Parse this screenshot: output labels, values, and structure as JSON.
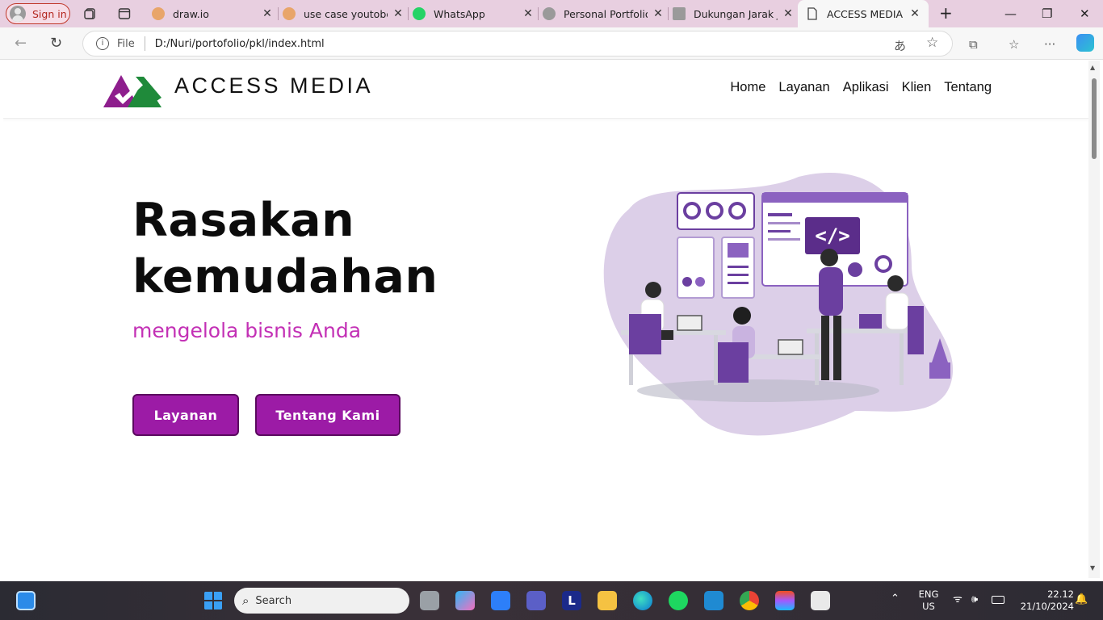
{
  "browser": {
    "signin_label": "Sign in",
    "tabs": [
      {
        "title": "draw.io",
        "color": "#e8a56a"
      },
      {
        "title": "use case youtobee",
        "color": "#e8a56a"
      },
      {
        "title": "WhatsApp",
        "color": "#25d366"
      },
      {
        "title": "Personal Portfolio",
        "color": "#9a9a9a"
      },
      {
        "title": "Dukungan Jarak Ja",
        "color": "#9a9a9a"
      },
      {
        "title": "ACCESS MEDIA",
        "color": "#555555"
      }
    ],
    "address": {
      "scheme_label": "File",
      "url": "D:/Nuri/portofolio/pkl/index.html"
    }
  },
  "site": {
    "brand": "ACCESS MEDIA",
    "nav": [
      "Home",
      "Layanan",
      "Aplikasi",
      "Klien",
      "Tentang"
    ],
    "hero": {
      "title_line1": "Rasakan",
      "title_line2": "kemudahan",
      "subtitle": "mengelola bisnis Anda",
      "button_primary": "Layanan",
      "button_secondary": "Tentang Kami"
    },
    "illustration_code_label": "</>",
    "colors": {
      "accent": "#9c1ba6",
      "subtitle": "#c330b5",
      "brand_green": "#1f8a3a"
    }
  },
  "taskbar": {
    "search_placeholder": "Search",
    "lang_line1": "ENG",
    "lang_line2": "US",
    "time": "22.12",
    "date": "21/10/2024"
  }
}
